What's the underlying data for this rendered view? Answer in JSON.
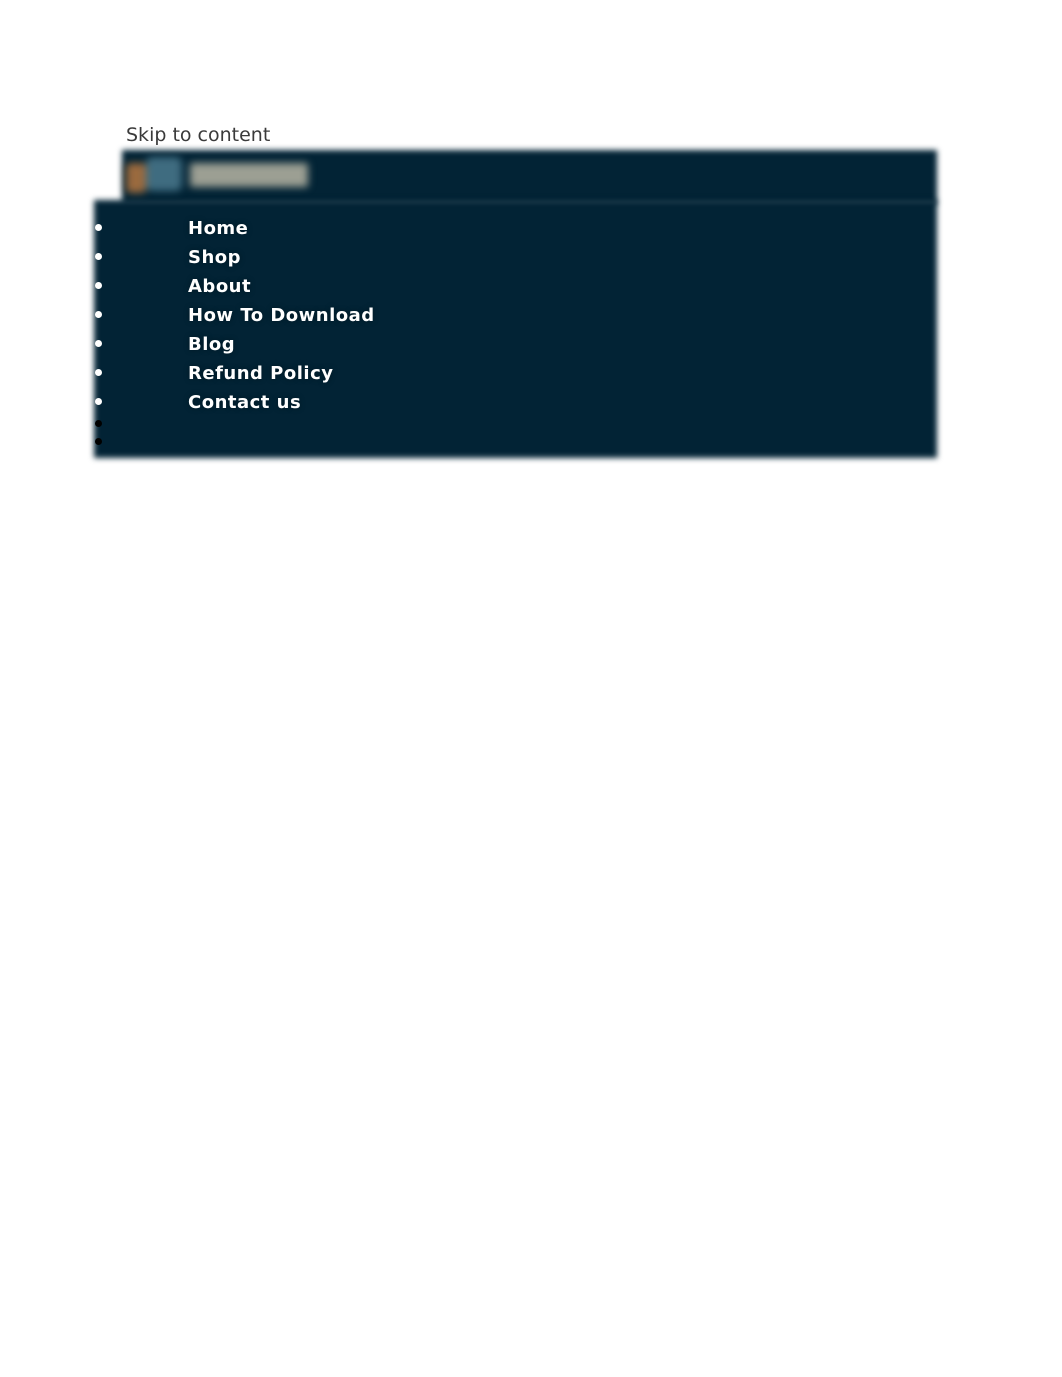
{
  "skip_link": "Skip to content",
  "header": {
    "background_color": "#022335",
    "logo": {
      "name": "site-logo",
      "colors": [
        "#9a6a3e",
        "#3f6c80",
        "#9c9f93"
      ]
    }
  },
  "nav": {
    "items": [
      {
        "label": "Home"
      },
      {
        "label": "Shop"
      },
      {
        "label": "About"
      },
      {
        "label": "How To Download"
      },
      {
        "label": "Blog"
      },
      {
        "label": "Refund Policy"
      },
      {
        "label": "Contact us"
      }
    ],
    "empty_items": 2
  }
}
